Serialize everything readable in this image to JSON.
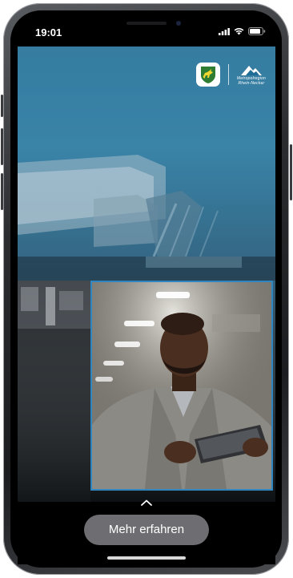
{
  "status_bar": {
    "time": "19:01"
  },
  "logos": {
    "metropolregion_line1": "Metropolregion",
    "metropolregion_line2": "Rhein-Neckar"
  },
  "cta": {
    "label": "Mehr erfahren"
  },
  "colors": {
    "screen_top": "#1f6d96",
    "screen_bottom": "#15191d",
    "photo_border": "#2f86c0",
    "button_bg": "#6e6e72"
  }
}
